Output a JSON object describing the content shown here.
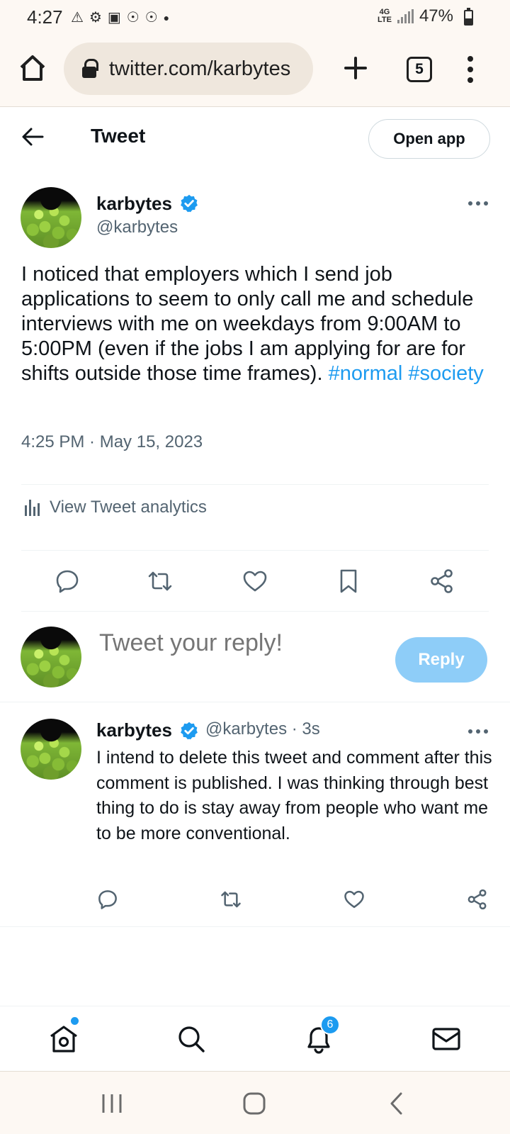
{
  "status_bar": {
    "time": "4:27",
    "network": "4G LTE",
    "battery_percent": "47%",
    "battery_level": 0.47
  },
  "browser": {
    "url": "twitter.com/karbytes",
    "tab_count": "5"
  },
  "header": {
    "title": "Tweet",
    "open_app_label": "Open app"
  },
  "tweet": {
    "author_name": "karbytes",
    "author_handle": "@karbytes",
    "text": "I noticed that employers which I send job applications to seem to only call me and schedule interviews with me on weekdays from 9:00AM to 5:00PM (even if the jobs I am applying for are for shifts outside those time frames).",
    "hashtags": [
      "#normal",
      "#society"
    ],
    "timestamp": "4:25 PM · May 15, 2023",
    "analytics_label": "View Tweet analytics"
  },
  "composer": {
    "placeholder": "Tweet your reply!",
    "reply_label": "Reply"
  },
  "reply": {
    "author_name": "karbytes",
    "author_handle": "@karbytes",
    "age": "· 3s",
    "text": "I intend to delete this tweet and comment after this comment is published. I was thinking through best thing to do is stay away from people who want me to be more conventional."
  },
  "bottom_nav": {
    "notifications_count": "6"
  },
  "colors": {
    "accent": "#1d9bf0",
    "reply_button_disabled": "#8ecdf8",
    "secondary_text": "#536471"
  }
}
